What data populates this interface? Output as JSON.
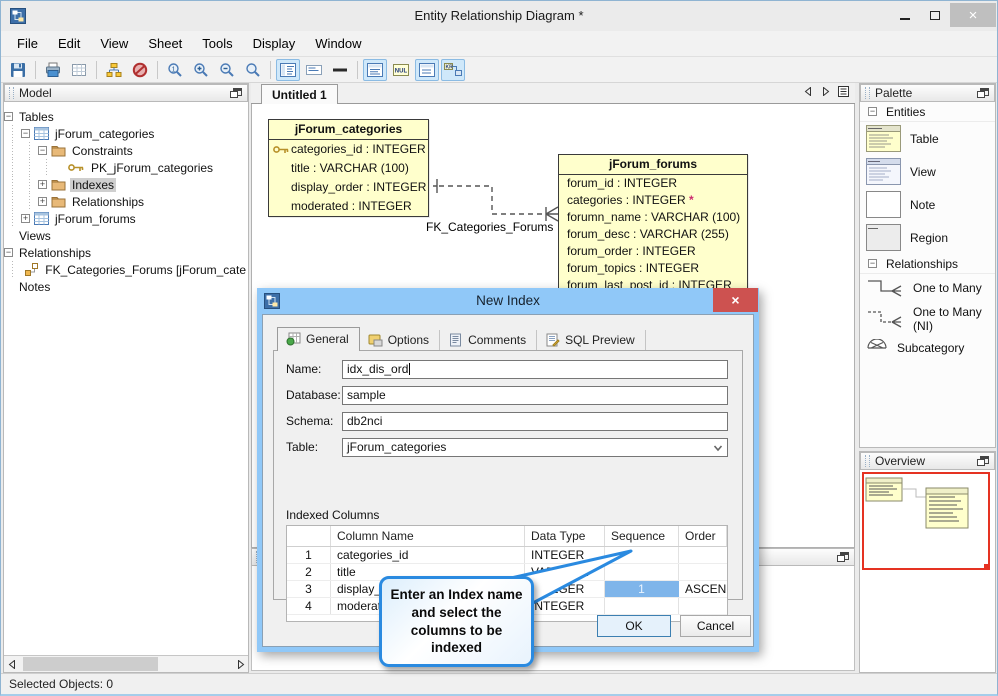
{
  "window": {
    "title": "Entity Relationship Diagram *",
    "controls": {
      "minimize_icon": "minimize-icon",
      "maximize_icon": "maximize-icon",
      "close_icon": "close-icon",
      "close_glyph": "×"
    }
  },
  "menu": {
    "items": [
      "File",
      "Edit",
      "View",
      "Sheet",
      "Tools",
      "Display",
      "Window"
    ]
  },
  "toolbar": {
    "buttons": [
      {
        "icon": "save"
      },
      {
        "sep": true
      },
      {
        "icon": "print"
      },
      {
        "icon": "grid"
      },
      {
        "sep": true
      },
      {
        "icon": "auto-layout"
      },
      {
        "icon": "cancel"
      },
      {
        "sep": true
      },
      {
        "icon": "zoom-actual"
      },
      {
        "icon": "zoom-in"
      },
      {
        "icon": "zoom-out"
      },
      {
        "icon": "zoom"
      },
      {
        "sep": true
      },
      {
        "icon": "view-outline",
        "toggled": true
      },
      {
        "icon": "view-compact"
      },
      {
        "icon": "view-minimal"
      },
      {
        "sep": true
      },
      {
        "icon": "view-details",
        "toggled": true
      },
      {
        "icon": "view-null"
      },
      {
        "icon": "view-list",
        "toggled": true
      },
      {
        "icon": "view-relation",
        "toggled": true
      }
    ]
  },
  "model_panel": {
    "title": "Model",
    "tree": [
      {
        "label": "Tables",
        "depth": 0,
        "expander": "minus",
        "icon": "none"
      },
      {
        "label": "jForum_categories",
        "depth": 1,
        "expander": "minus",
        "icon": "table"
      },
      {
        "label": "Constraints",
        "depth": 2,
        "expander": "minus",
        "icon": "folder"
      },
      {
        "label": "PK_jForum_categories",
        "depth": 3,
        "expander": "none",
        "icon": "key"
      },
      {
        "label": "Indexes",
        "depth": 2,
        "expander": "plus",
        "icon": "folder",
        "selected": true
      },
      {
        "label": "Relationships",
        "depth": 2,
        "expander": "plus",
        "icon": "folder"
      },
      {
        "label": "jForum_forums",
        "depth": 1,
        "expander": "plus",
        "icon": "table"
      },
      {
        "label": "Views",
        "depth": 0,
        "expander": "none",
        "icon": "none"
      },
      {
        "label": "Relationships",
        "depth": 0,
        "expander": "minus",
        "icon": "none"
      },
      {
        "label": "FK_Categories_Forums [jForum_cate",
        "depth": 1,
        "expander": "none",
        "icon": "fk"
      },
      {
        "label": "Notes",
        "depth": 0,
        "expander": "none",
        "icon": "none"
      }
    ]
  },
  "canvas": {
    "tab": "Untitled 1",
    "relationship_label": "FK_Categories_Forums",
    "tables": [
      {
        "name": "jForum_categories",
        "icon_gutter": true,
        "columns": [
          {
            "text": "categories_id : INTEGER",
            "key": true
          },
          {
            "text": "title : VARCHAR (100)"
          },
          {
            "text": "display_order : INTEGER"
          },
          {
            "text": "moderated : INTEGER"
          }
        ]
      },
      {
        "name": "jForum_forums",
        "icon_gutter": false,
        "columns": [
          {
            "text": "forum_id : INTEGER"
          },
          {
            "text": "categories : INTEGER",
            "required": true
          },
          {
            "text": "forumn_name : VARCHAR (100)"
          },
          {
            "text": "forum_desc : VARCHAR (255)"
          },
          {
            "text": "forum_order : INTEGER"
          },
          {
            "text": "forum_topics : INTEGER"
          },
          {
            "text": "forum_last_post_id : INTEGER"
          }
        ]
      }
    ]
  },
  "palette": {
    "title": "Palette",
    "sections": [
      {
        "label": "Entities",
        "items": [
          {
            "label": "Table",
            "icon": "thumb-table"
          },
          {
            "label": "View",
            "icon": "thumb-view"
          },
          {
            "label": "Note",
            "icon": "thumb-note"
          },
          {
            "label": "Region",
            "icon": "thumb-region"
          }
        ]
      },
      {
        "label": "Relationships",
        "items": [
          {
            "label": "One to Many",
            "icon": "rel-one-to-many"
          },
          {
            "label": "One to Many (NI)",
            "icon": "rel-one-to-many-ni"
          },
          {
            "label": "Subcategory",
            "icon": "rel-subcategory"
          }
        ]
      }
    ]
  },
  "overview": {
    "title": "Overview"
  },
  "dialog": {
    "title": "New Index",
    "tabs": [
      {
        "label": "General",
        "icon": "tab-general",
        "active": true
      },
      {
        "label": "Options",
        "icon": "tab-options"
      },
      {
        "label": "Comments",
        "icon": "tab-comments"
      },
      {
        "label": "SQL Preview",
        "icon": "tab-sql"
      }
    ],
    "fields": [
      {
        "label": "Name:",
        "value": "idx_dis_ord",
        "caret": true
      },
      {
        "label": "Database:",
        "value": "sample"
      },
      {
        "label": "Schema:",
        "value": "db2nci"
      },
      {
        "label": "Table:",
        "value": "jForum_categories",
        "combo": true
      }
    ],
    "indexed_columns_label": "Indexed Columns",
    "grid": {
      "headers": [
        "",
        "Column Name",
        "Data Type",
        "Sequence",
        "Order"
      ],
      "rows": [
        {
          "num": "1",
          "column_name": "categories_id",
          "data_type": "INTEGER",
          "sequence": "",
          "order": ""
        },
        {
          "num": "2",
          "column_name": "title",
          "data_type": "VARCHAR",
          "sequence": "",
          "order": ""
        },
        {
          "num": "3",
          "column_name": "display_order",
          "data_type": "INTEGER",
          "sequence": "1",
          "order": "ASCENDING",
          "sequence_selected": true
        },
        {
          "num": "4",
          "column_name": "moderated",
          "data_type": "INTEGER",
          "sequence": "",
          "order": ""
        }
      ]
    },
    "buttons": {
      "ok": "OK",
      "cancel": "Cancel"
    }
  },
  "callout": {
    "text": "Enter an Index name and select the columns to be indexed"
  },
  "status_bar": {
    "text": "Selected Objects: 0"
  },
  "colors": {
    "dialog_titlebar": "#90c8f8",
    "dialog_close": "#cd5250",
    "selected_cell": "#7fb5ea",
    "entity_fill": "#ffffcc",
    "callout_border": "#2a8ae0",
    "overview_viewport": "#e53222",
    "toggled_button_bg": "#cfe8fa"
  }
}
